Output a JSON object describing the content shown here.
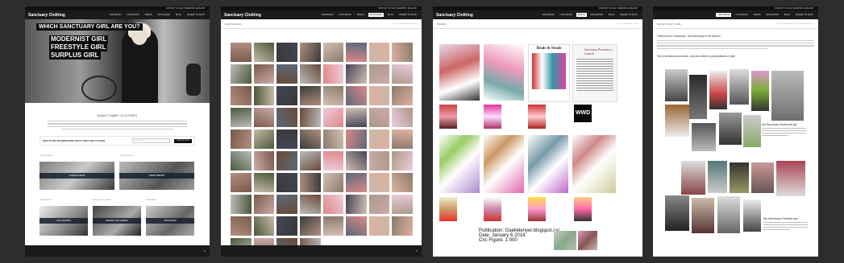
{
  "screens": [
    {
      "id": "home",
      "topbar": "CONTACT US | EN | SWEDISH | ENGLISH",
      "brand": "Sanctuary Clothing",
      "menu": [
        "THE BRAND",
        "LOOK BOOK",
        "PRESS",
        "INSTAGRAM",
        "BLOG",
        "WHERE TO SHOP"
      ],
      "active_menu": "",
      "hero_question": "WHICH SANCTUARY GIRL ARE YOU?",
      "hero_lines": [
        "MODERNIST GIRL",
        "FREESTYLE GIRL",
        "SURPLUS GIRL"
      ],
      "section_title": "SANCTUARY CLOTHES",
      "signup_text": "SIGN UP FOR UPCOMING NEWS ABOUT SANCTUARY CLOTHES",
      "signup_placeholder": "E-mail address",
      "signup_button": "SIGN UP NOW",
      "tiles_top": [
        {
          "caption": "RECENT NEWS",
          "label": "FASHION NEWS"
        },
        {
          "caption": "TREND REPORT",
          "label": "TREND REPORT"
        }
      ],
      "tiles_bottom": [
        {
          "caption": "TALE BOARDS",
          "label": "TALE BOARDS"
        },
        {
          "caption": "BEHIND THE SCENES",
          "label": "BEHIND THE SCENES"
        },
        {
          "caption": "INSTAGRAM",
          "label": "INSTAGRAM"
        }
      ]
    },
    {
      "id": "instagram",
      "topbar": "CONTACT US | EN | SWEDISH | ENGLISH",
      "brand": "Sanctuary Clothing",
      "menu": [
        "THE BRAND",
        "LOOK BOOK",
        "PRESS",
        "INSTAGRAM",
        "BLOG",
        "WHERE TO SHOP"
      ],
      "active_menu": "INSTAGRAM",
      "page_title": "INSTAGRAM",
      "breadcrumb": "You are here: Home / Instagram"
    },
    {
      "id": "press",
      "topbar": "CONTACT US | EN | SWEDISH | ENGLISH",
      "brand": "Sanctuary Clothing",
      "menu": [
        "THE BRAND",
        "LOOK BOOK",
        "PRESS",
        "INSTAGRAM",
        "BLOG",
        "WHERE TO SHOP"
      ],
      "active_menu": "PRESS",
      "page_title": "PRESS",
      "breadcrumb": "You are here: Home / Press",
      "press_heads": [
        "Deals & Steals",
        "Sanctuary Presents to Launch"
      ],
      "wwd_label": "WWD",
      "publication": [
        "Publication: Gaellelenyer.blogspot.ca/",
        "Date: January 6 2014",
        "Circ Figure: 1 000"
      ]
    },
    {
      "id": "girl",
      "topbar": "CONTACT US | EN | SWEDISH | ENGLISH",
      "brand": "",
      "menu": [
        "THE BRAND",
        "LOOK BOOK",
        "PRESS",
        "INSTAGRAM",
        "BLOG",
        "WHERE TO SHOP"
      ],
      "active_menu": "THE BRAND",
      "page_title": "SANCTUARY GIRL",
      "breadcrumb": "You are here: Home / The Brand / Sanctuary Girl",
      "intro": "Fashion is her Sanctuary - and Sanctuary is her fashion",
      "line2": "She is timeless and modern, and she defines a great attitude of style",
      "modernist_title": "the Sanctuary Modernist girl",
      "freestyle_title": "the Sanctuary Freestyle girl"
    }
  ],
  "colors": {
    "nav": "#1b1b1b",
    "page_bg": "#2d2d2d",
    "tile_band": "#1e2d3c"
  }
}
